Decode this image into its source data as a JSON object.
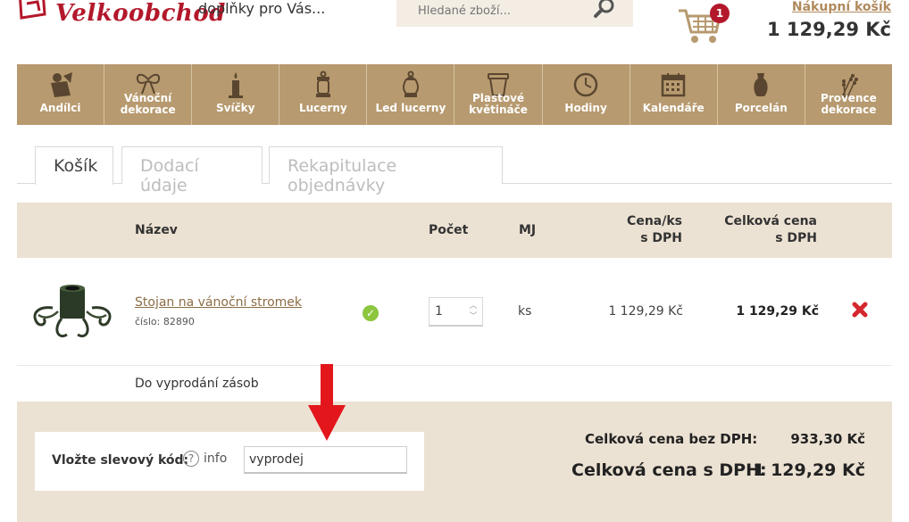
{
  "header": {
    "logo_text": "Velkoobchod",
    "tagline": "doplňky pro Vás...",
    "search_placeholder": "Hledané zboží...",
    "cart_count": "1",
    "cart_link": "Nákupní košík",
    "cart_total": "1 129,29 Kč"
  },
  "nav": {
    "items": [
      {
        "label": "Andílci",
        "icon": "angel-icon"
      },
      {
        "label": "Vánoční dekorace",
        "icon": "bow-icon"
      },
      {
        "label": "Svíčky",
        "icon": "candle-icon"
      },
      {
        "label": "Lucerny",
        "icon": "lantern-icon"
      },
      {
        "label": "Led lucerny",
        "icon": "led-lantern-icon"
      },
      {
        "label": "Plastové květináče",
        "icon": "flowerpot-icon"
      },
      {
        "label": "Hodiny",
        "icon": "clock-icon"
      },
      {
        "label": "Kalendáře",
        "icon": "calendar-icon"
      },
      {
        "label": "Porcelán",
        "icon": "vase-icon"
      },
      {
        "label": "Provence dekorace",
        "icon": "lavender-icon"
      }
    ]
  },
  "tabs": [
    {
      "label": "Košík",
      "active": true
    },
    {
      "label": "Dodací údaje",
      "active": false
    },
    {
      "label": "Rekapitulace objednávky",
      "active": false
    }
  ],
  "table": {
    "headers": {
      "name": "Název",
      "qty": "Počet",
      "unit": "MJ",
      "unit_price_1": "Cena/ks",
      "unit_price_2": "s DPH",
      "total_price_1": "Celková cena",
      "total_price_2": "s DPH"
    },
    "rows": [
      {
        "name": "Stojan na vánoční stromek",
        "code": "číslo: 82890",
        "qty": "1",
        "unit": "ks",
        "unit_price": "1 129,29 Kč",
        "total_price": "1 129,29 Kč",
        "availability": "Do vyprodání zásob"
      }
    ]
  },
  "coupon": {
    "label": "Vložte slevový kód:",
    "info_icon": "?",
    "info_label": "info",
    "value": "vyprodej"
  },
  "summary": {
    "without_vat_label": "Celková cena bez DPH:",
    "without_vat_value": "933,30 Kč",
    "with_vat_label": "Celková cena s DPH:",
    "with_vat_value": "1 129,29 Kč"
  },
  "colors": {
    "brand_red": "#b3182b",
    "nav_brown": "#b79a6f",
    "panel_beige": "#ece2d3",
    "link_brown": "#8c6d45",
    "ok_green": "#8cc63f"
  }
}
